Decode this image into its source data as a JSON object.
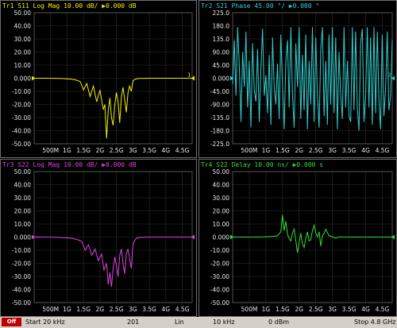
{
  "chart_data": [
    {
      "type": "line",
      "trace": "Tr1",
      "title": "Tr1 S11 Log Mag 10.00 dB/ ▶0.000 dB",
      "color": "#f0f000",
      "ref_label": "1",
      "ylim": [
        -50,
        50
      ],
      "yticks": [
        "50.00",
        "40.00",
        "30.00",
        "20.00",
        "10.00",
        "0.000",
        "-10.00",
        "-20.00",
        "-30.00",
        "-40.00",
        "-50.00"
      ],
      "xlim": [
        0,
        4.8
      ],
      "xticks": [
        {
          "v": 0.5,
          "label": "500M"
        },
        {
          "v": 1,
          "label": "1G"
        },
        {
          "v": 1.5,
          "label": "1.5G"
        },
        {
          "v": 2,
          "label": "2G"
        },
        {
          "v": 2.5,
          "label": "2.5G"
        },
        {
          "v": 3,
          "label": "3G"
        },
        {
          "v": 3.5,
          "label": "3.5G"
        },
        {
          "v": 4,
          "label": "4G"
        },
        {
          "v": 4.5,
          "label": "4.5G"
        }
      ],
      "x": [
        0,
        0.4,
        0.8,
        1.1,
        1.25,
        1.4,
        1.5,
        1.6,
        1.7,
        1.8,
        1.9,
        2.0,
        2.1,
        2.15,
        2.2,
        2.25,
        2.3,
        2.35,
        2.4,
        2.45,
        2.5,
        2.55,
        2.6,
        2.65,
        2.7,
        2.75,
        2.8,
        2.85,
        2.9,
        2.95,
        3.0,
        3.05,
        3.1,
        3.2,
        3.5,
        4.0,
        4.5,
        4.8
      ],
      "y": [
        0,
        0,
        -0.2,
        -0.6,
        -1.2,
        -2.5,
        -9,
        -4,
        -14,
        -6,
        -18,
        -9,
        -24,
        -20,
        -46,
        -25,
        -15,
        -30,
        -36,
        -20,
        -11,
        -18,
        -34,
        -14,
        -7,
        -16,
        -26,
        -11,
        -6,
        -10,
        -2,
        -1,
        -0.5,
        -0.2,
        0,
        0,
        0,
        0
      ]
    },
    {
      "type": "line",
      "trace": "Tr2",
      "title": "Tr2 S21 Phase 45.00 °/ ▶0.000 °",
      "color": "#30d0d0",
      "ref_label": "2",
      "ylim": [
        -225,
        225
      ],
      "yticks": [
        "225.0",
        "180.0",
        "135.0",
        "90.00",
        "45.00",
        "0.000",
        "-45.00",
        "-90.00",
        "-135.0",
        "-180.0",
        "-225.0"
      ],
      "xlim": [
        0,
        4.8
      ],
      "xticks": [
        {
          "v": 0.5,
          "label": "500M"
        },
        {
          "v": 1,
          "label": "1G"
        },
        {
          "v": 1.5,
          "label": "1.5G"
        },
        {
          "v": 2,
          "label": "2G"
        },
        {
          "v": 2.5,
          "label": "2.5G"
        },
        {
          "v": 3,
          "label": "3G"
        },
        {
          "v": 3.5,
          "label": "3.5G"
        },
        {
          "v": 4,
          "label": "4G"
        },
        {
          "v": 4.5,
          "label": "4.5G"
        }
      ],
      "x": [
        0,
        0.05,
        0.1,
        0.15,
        0.2,
        0.25,
        0.3,
        0.35,
        0.4,
        0.45,
        0.5,
        0.55,
        0.6,
        0.65,
        0.7,
        0.75,
        0.8,
        0.85,
        0.9,
        0.95,
        1.0,
        1.05,
        1.1,
        1.15,
        1.2,
        1.25,
        1.3,
        1.35,
        1.4,
        1.45,
        1.5,
        1.55,
        1.6,
        1.65,
        1.7,
        1.75,
        1.8,
        1.85,
        1.9,
        1.95,
        2.0,
        2.05,
        2.1,
        2.15,
        2.2,
        2.25,
        2.3,
        2.35,
        2.4,
        2.45,
        2.5,
        2.55,
        2.6,
        2.65,
        2.7,
        2.75,
        2.8,
        2.85,
        2.9,
        2.95,
        3.0,
        3.05,
        3.1,
        3.15,
        3.2,
        3.25,
        3.3,
        3.35,
        3.4,
        3.45,
        3.5,
        3.55,
        3.6,
        3.65,
        3.7,
        3.75,
        3.8,
        3.85,
        3.9,
        3.95,
        4.0,
        4.05,
        4.1,
        4.15,
        4.2,
        4.25,
        4.3,
        4.35,
        4.4,
        4.45,
        4.5,
        4.55,
        4.6,
        4.65,
        4.7,
        4.75,
        4.8
      ],
      "y": [
        -20,
        130,
        -60,
        175,
        40,
        -150,
        90,
        -30,
        160,
        -100,
        60,
        -170,
        120,
        -40,
        -80,
        100,
        -150,
        30,
        170,
        -60,
        10,
        -120,
        80,
        -160,
        140,
        -30,
        -90,
        50,
        -140,
        150,
        -20,
        -175,
        60,
        130,
        -100,
        175,
        -60,
        -170,
        120,
        -30,
        175,
        -140,
        80,
        -110,
        150,
        -175,
        60,
        -90,
        175,
        -150,
        140,
        -60,
        -170,
        100,
        175,
        -130,
        60,
        -160,
        150,
        -90,
        175,
        -120,
        140,
        -175,
        90,
        -60,
        -140,
        175,
        -100,
        60,
        -130,
        -150,
        175,
        -110,
        160,
        -100,
        -180,
        120,
        170,
        -150,
        -60,
        175,
        -100,
        140,
        -160,
        175,
        -120,
        160,
        -80,
        -175,
        150,
        -130,
        -40,
        160,
        -110,
        -60,
        130
      ]
    },
    {
      "type": "line",
      "trace": "Tr3",
      "title": "Tr3 S22 Log Mag 10.00 dB/ ▶0.000 dB",
      "color": "#e040e0",
      "ref_label": "",
      "ylim": [
        -50,
        50
      ],
      "yticks": [
        "50.00",
        "40.00",
        "30.00",
        "20.00",
        "10.00",
        "0.000",
        "-10.00",
        "-20.00",
        "-30.00",
        "-40.00",
        "-50.00"
      ],
      "xlim": [
        0,
        4.8
      ],
      "xticks": [
        {
          "v": 0.5,
          "label": "500M"
        },
        {
          "v": 1,
          "label": "1G"
        },
        {
          "v": 1.5,
          "label": "1.5G"
        },
        {
          "v": 2,
          "label": "2G"
        },
        {
          "v": 2.5,
          "label": "2.5G"
        },
        {
          "v": 3,
          "label": "3G"
        },
        {
          "v": 3.5,
          "label": "3.5G"
        },
        {
          "v": 4,
          "label": "4G"
        },
        {
          "v": 4.5,
          "label": "4.5G"
        }
      ],
      "x": [
        0,
        0.4,
        0.8,
        1.1,
        1.3,
        1.45,
        1.55,
        1.65,
        1.75,
        1.85,
        1.95,
        2.05,
        2.12,
        2.2,
        2.25,
        2.3,
        2.35,
        2.4,
        2.45,
        2.5,
        2.55,
        2.6,
        2.65,
        2.7,
        2.75,
        2.8,
        2.85,
        2.9,
        2.95,
        3.0,
        3.05,
        3.1,
        3.2,
        3.5,
        4.0,
        4.5,
        4.8
      ],
      "y": [
        0,
        0,
        -0.3,
        -0.8,
        -1.8,
        -3.5,
        -10,
        -6,
        -14,
        -9,
        -18,
        -13,
        -25,
        -20,
        -36,
        -27,
        -38,
        -24,
        -15,
        -22,
        -30,
        -14,
        -9,
        -20,
        -28,
        -13,
        -9,
        -16,
        -24,
        -6,
        -3,
        -1,
        -0.3,
        0,
        0,
        0,
        0
      ]
    },
    {
      "type": "line",
      "trace": "Tr4",
      "title": "Tr4 S22 Delay 10.00 ns/ ▶0.000 s",
      "color": "#30e030",
      "ref_label": "",
      "ylim": [
        -50,
        50
      ],
      "yticks": [
        "50.00",
        "40.00",
        "30.00",
        "20.00",
        "10.00",
        "0.000",
        "-10.00",
        "-20.00",
        "-30.00",
        "-40.00",
        "-50.00"
      ],
      "xlim": [
        0,
        4.8
      ],
      "xticks": [
        {
          "v": 0.5,
          "label": "500M"
        },
        {
          "v": 1,
          "label": "1G"
        },
        {
          "v": 1.5,
          "label": "1.5G"
        },
        {
          "v": 2,
          "label": "2G"
        },
        {
          "v": 2.5,
          "label": "2.5G"
        },
        {
          "v": 3,
          "label": "3G"
        },
        {
          "v": 3.5,
          "label": "3.5G"
        },
        {
          "v": 4,
          "label": "4G"
        },
        {
          "v": 4.5,
          "label": "4.5G"
        }
      ],
      "x": [
        0,
        0.8,
        1.2,
        1.35,
        1.45,
        1.5,
        1.55,
        1.6,
        1.65,
        1.7,
        1.75,
        1.8,
        1.85,
        1.9,
        1.95,
        2.0,
        2.05,
        2.1,
        2.15,
        2.2,
        2.25,
        2.3,
        2.35,
        2.4,
        2.45,
        2.5,
        2.55,
        2.6,
        2.65,
        2.7,
        2.75,
        2.8,
        2.9,
        3.0,
        3.1,
        3.2,
        3.5,
        4.0,
        4.5,
        4.8
      ],
      "y": [
        0,
        0,
        0.5,
        1,
        4,
        17,
        5,
        12,
        2,
        -1,
        -3,
        3,
        6,
        -3,
        -12,
        -4,
        3,
        -5,
        -8,
        -1,
        4,
        -3,
        -2,
        5,
        9,
        3,
        0,
        4,
        -7,
        1,
        3,
        6,
        1,
        0.3,
        -0.8,
        0.2,
        0,
        0,
        0,
        0
      ]
    }
  ],
  "status_bar": {
    "mode": "Off",
    "start": "Start 20 kHz",
    "points": "201",
    "sweep_type": "Lin",
    "ifbw": "10 kHz",
    "power": "0 dBm",
    "stop": "Stop 4.8 GHz"
  }
}
